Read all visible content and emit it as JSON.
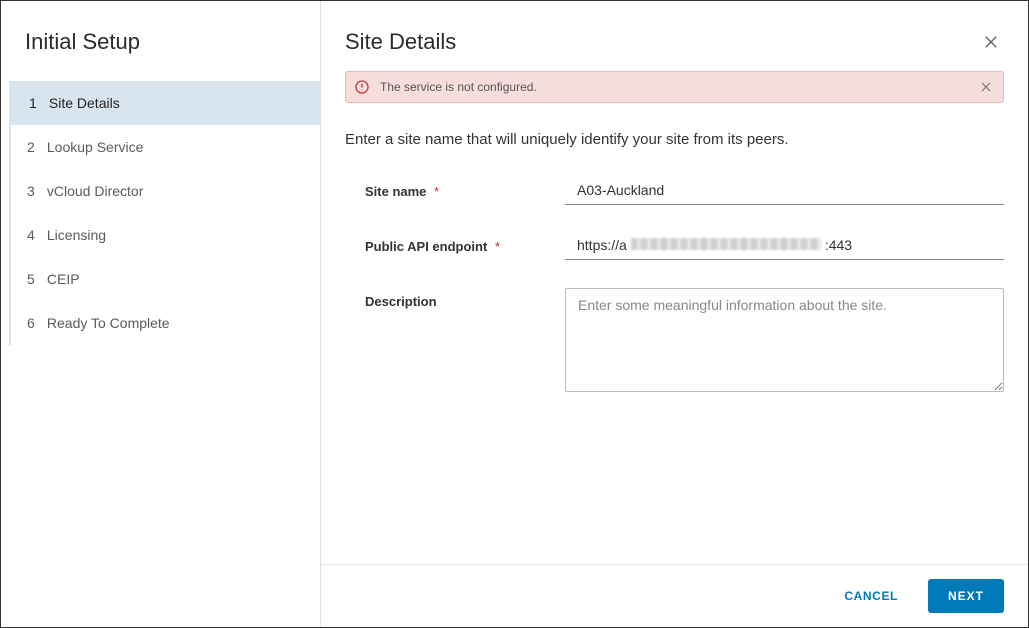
{
  "sidebar": {
    "title": "Initial Setup",
    "steps": [
      {
        "num": "1",
        "label": "Site Details",
        "active": true
      },
      {
        "num": "2",
        "label": "Lookup Service",
        "active": false
      },
      {
        "num": "3",
        "label": "vCloud Director",
        "active": false
      },
      {
        "num": "4",
        "label": "Licensing",
        "active": false
      },
      {
        "num": "5",
        "label": "CEIP",
        "active": false
      },
      {
        "num": "6",
        "label": "Ready To Complete",
        "active": false
      }
    ]
  },
  "header": {
    "title": "Site Details"
  },
  "alert": {
    "text": "The service is not configured."
  },
  "intro": "Enter a site name that will uniquely identify your site from its peers.",
  "form": {
    "site_name_label": "Site name",
    "site_name_value": "A03-Auckland",
    "endpoint_label": "Public API endpoint",
    "endpoint_prefix": "https://a",
    "endpoint_suffix": ":443",
    "description_label": "Description",
    "description_placeholder": "Enter some meaningful information about the site."
  },
  "footer": {
    "cancel": "CANCEL",
    "next": "NEXT"
  }
}
